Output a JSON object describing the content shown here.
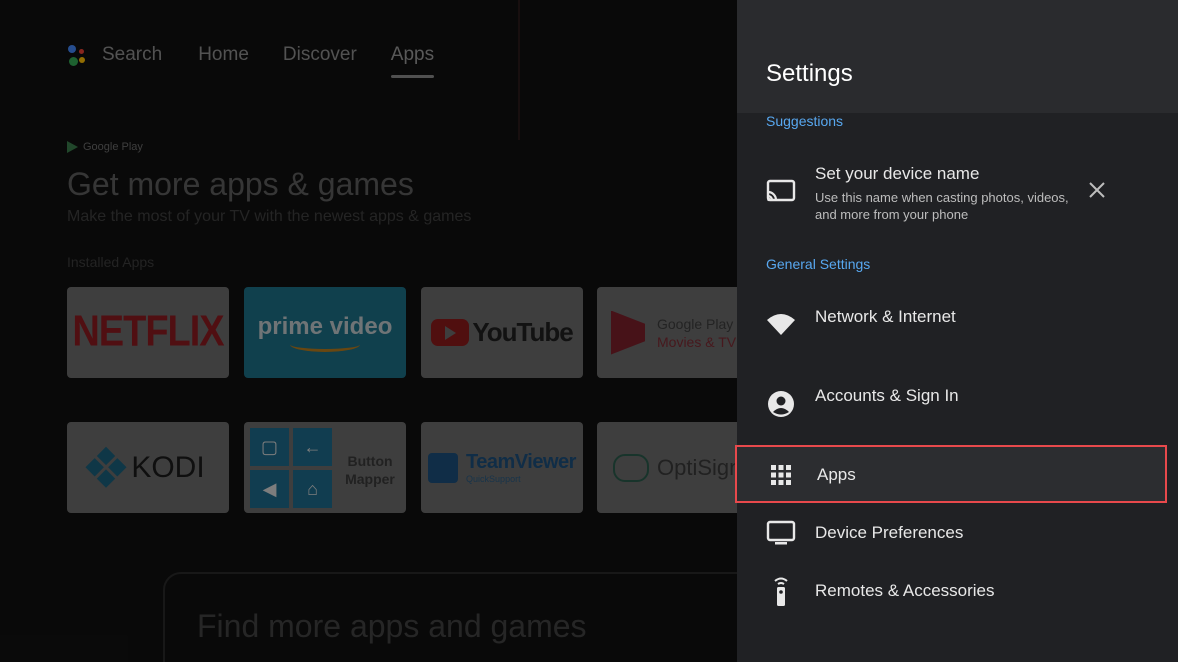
{
  "home": {
    "nav": {
      "search": "Search",
      "items": [
        "Home",
        "Discover",
        "Apps"
      ],
      "active": "Apps"
    },
    "promo": {
      "store_label": "Google Play",
      "title": "Get more apps & games",
      "subtitle": "Make the most of your TV with the newest apps & games"
    },
    "installed_label": "Installed Apps",
    "apps": {
      "netflix": "NETFLIX",
      "prime": "prime video",
      "youtube": "YouTube",
      "gp_movies_1": "Google Play",
      "gp_movies_2": "Movies & TV",
      "kodi": "KODI",
      "button_mapper_1": "Button",
      "button_mapper_2": "Mapper",
      "teamviewer_1": "TeamViewer",
      "teamviewer_2": "QuickSupport",
      "optisigns": "OptiSign"
    },
    "find_more": "Find more apps and games"
  },
  "settings": {
    "title": "Settings",
    "suggestions_header": "Suggestions",
    "device_name": {
      "title": "Set your device name",
      "description": "Use this name when casting photos, videos, and more from your phone"
    },
    "general_header": "General Settings",
    "items": {
      "network": "Network & Internet",
      "accounts": "Accounts & Sign In",
      "apps": "Apps",
      "device_prefs": "Device Preferences",
      "remotes": "Remotes & Accessories"
    }
  },
  "colors": {
    "accent_blue": "#58a8f0",
    "highlight_red": "#e8494c",
    "panel_bg": "#202124"
  }
}
